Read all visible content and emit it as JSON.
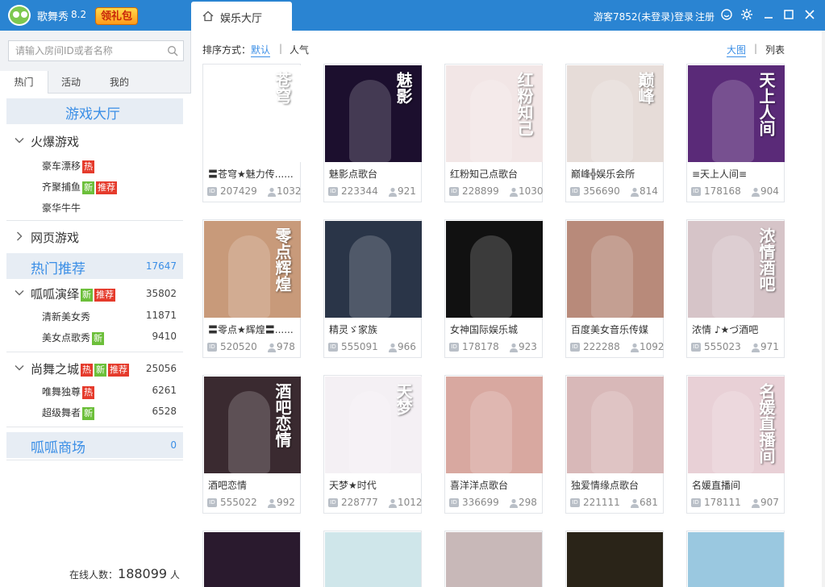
{
  "titlebar": {
    "app_name": "歌舞秀",
    "version": "8.2",
    "promo_label": "领礼包",
    "active_tab": "娱乐大厅",
    "user_status": "游客7852(未登录)",
    "login_label": "登录",
    "register_label": "注册"
  },
  "sidebar": {
    "search_placeholder": "请输入房间ID或者名称",
    "tabs": [
      "热门",
      "活动",
      "我的"
    ],
    "game_hall": "游戏大厅",
    "hot_games": {
      "label": "火爆游戏",
      "items": [
        {
          "label": "豪车漂移",
          "badges": [
            "热"
          ]
        },
        {
          "label": "齐聚捕鱼",
          "badges": [
            "新",
            "推荐"
          ]
        },
        {
          "label": "豪华牛牛",
          "badges": []
        }
      ]
    },
    "web_games": "网页游戏",
    "hot_recommend": {
      "label": "热门推荐",
      "count": "17647"
    },
    "guagua": {
      "label": "呱呱演绎",
      "badges": [
        "新",
        "推荐"
      ],
      "count": "35802",
      "items": [
        {
          "label": "清新美女秀",
          "badges": [],
          "count": "11871"
        },
        {
          "label": "美女点歌秀",
          "badges": [
            "新"
          ],
          "count": "9410"
        }
      ]
    },
    "dance_city": {
      "label": "尚舞之城",
      "badges": [
        "热",
        "新",
        "推荐"
      ],
      "count": "25056",
      "items": [
        {
          "label": "唯舞独尊",
          "badges": [
            "热"
          ],
          "count": "6261"
        },
        {
          "label": "超级舞者",
          "badges": [
            "新"
          ],
          "count": "6528"
        }
      ]
    },
    "mall": {
      "label": "呱呱商场",
      "count": "0"
    },
    "online_label": "在线人数：",
    "online_count": "188099",
    "online_unit": "人"
  },
  "main": {
    "sort_label": "排序方式：",
    "sort_default": "默认",
    "sort_popular": "人气",
    "view_big": "大图",
    "view_list": "列表",
    "rooms": [
      {
        "name": "〓苍穹★魅力传......",
        "id": "207429",
        "count": "1032",
        "bg": "#ffffff",
        "cap": "苍穹"
      },
      {
        "name": "魅影点歌台",
        "id": "223344",
        "count": "921",
        "bg": "#1c0f2e",
        "cap": "魅影"
      },
      {
        "name": "红粉知己点歌台",
        "id": "228899",
        "count": "1030",
        "bg": "#f2e6e6",
        "cap": "红粉知己"
      },
      {
        "name": "巅峰╬娱乐会所",
        "id": "356690",
        "count": "814",
        "bg": "#e6dcd8",
        "cap": "巅峰"
      },
      {
        "name": "≡天上人间≡",
        "id": "178168",
        "count": "904",
        "bg": "#5a2a78",
        "cap": "天上人间"
      },
      {
        "name": "〓零点★辉煌〓......",
        "id": "520520",
        "count": "978",
        "bg": "#c89a7a",
        "cap": "零点辉煌"
      },
      {
        "name": "精灵ゞ家族",
        "id": "555091",
        "count": "966",
        "bg": "#2a3548",
        "cap": ""
      },
      {
        "name": "女神国际娱乐城",
        "id": "178178",
        "count": "923",
        "bg": "#111111",
        "cap": ""
      },
      {
        "name": "百度美女音乐传媒",
        "id": "222288",
        "count": "1092",
        "bg": "#b88a7a",
        "cap": ""
      },
      {
        "name": "浓情 ♪★づ酒吧",
        "id": "555023",
        "count": "971",
        "bg": "#d6c4c8",
        "cap": "浓情酒吧"
      },
      {
        "name": "酒吧恋情",
        "id": "555022",
        "count": "992",
        "bg": "#3a2a30",
        "cap": "酒吧恋情"
      },
      {
        "name": "天梦★时代",
        "id": "228777",
        "count": "1012",
        "bg": "#f4f0f4",
        "cap": "天梦"
      },
      {
        "name": "喜洋洋点歌台",
        "id": "336699",
        "count": "298",
        "bg": "#d8a8a0",
        "cap": ""
      },
      {
        "name": "独爱情缘点歌台",
        "id": "221111",
        "count": "681",
        "bg": "#d8b8b8",
        "cap": ""
      },
      {
        "name": "名媛直播间",
        "id": "178111",
        "count": "907",
        "bg": "#e8d0d6",
        "cap": "名媛直播间"
      }
    ],
    "partial_rooms": [
      {
        "bg": "#2a1a2e"
      },
      {
        "bg": "#cfe6ea"
      },
      {
        "bg": "#c8b8b8"
      },
      {
        "bg": "#2a2418"
      },
      {
        "bg": "#9ac8e0"
      }
    ]
  },
  "colors": {
    "accent": "#2a84d2",
    "link": "#3a8ee6",
    "hot": "#e53b2c",
    "new": "#6cbf3a"
  }
}
